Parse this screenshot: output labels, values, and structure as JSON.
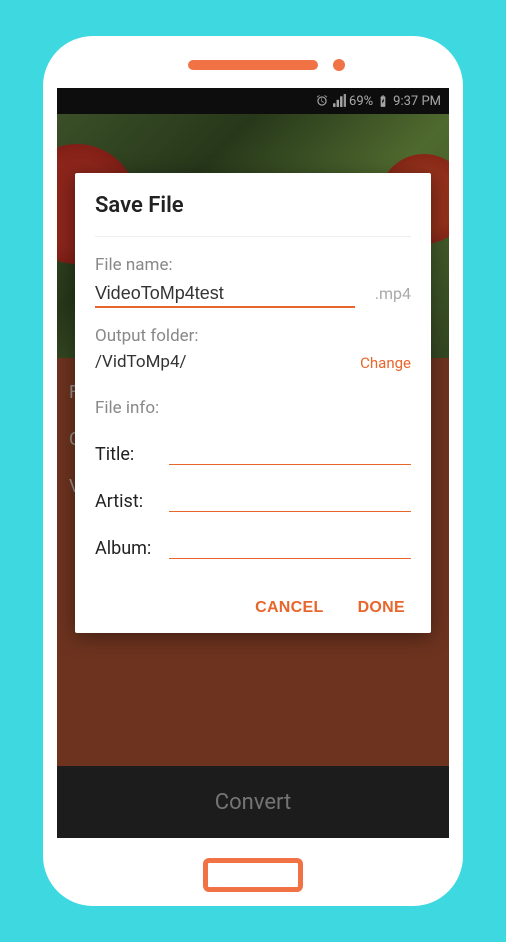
{
  "statusBar": {
    "battery": "69%",
    "time": "9:37 PM"
  },
  "background": {
    "leftPeek": [
      "Fi",
      "C",
      "Vi"
    ]
  },
  "bottomBar": {
    "convert": "Convert"
  },
  "dialog": {
    "title": "Save File",
    "fileNameLabel": "File name:",
    "fileNameValue": "VideoToMp4test",
    "fileExtension": ".mp4",
    "outputFolderLabel": "Output folder:",
    "outputFolderPath": "/VidToMp4/",
    "changeLabel": "Change",
    "fileInfoLabel": "File info:",
    "titleLabel": "Title:",
    "titleValue": "",
    "artistLabel": "Artist:",
    "artistValue": "",
    "albumLabel": "Album:",
    "albumValue": "",
    "cancel": "CANCEL",
    "done": "DONE"
  }
}
